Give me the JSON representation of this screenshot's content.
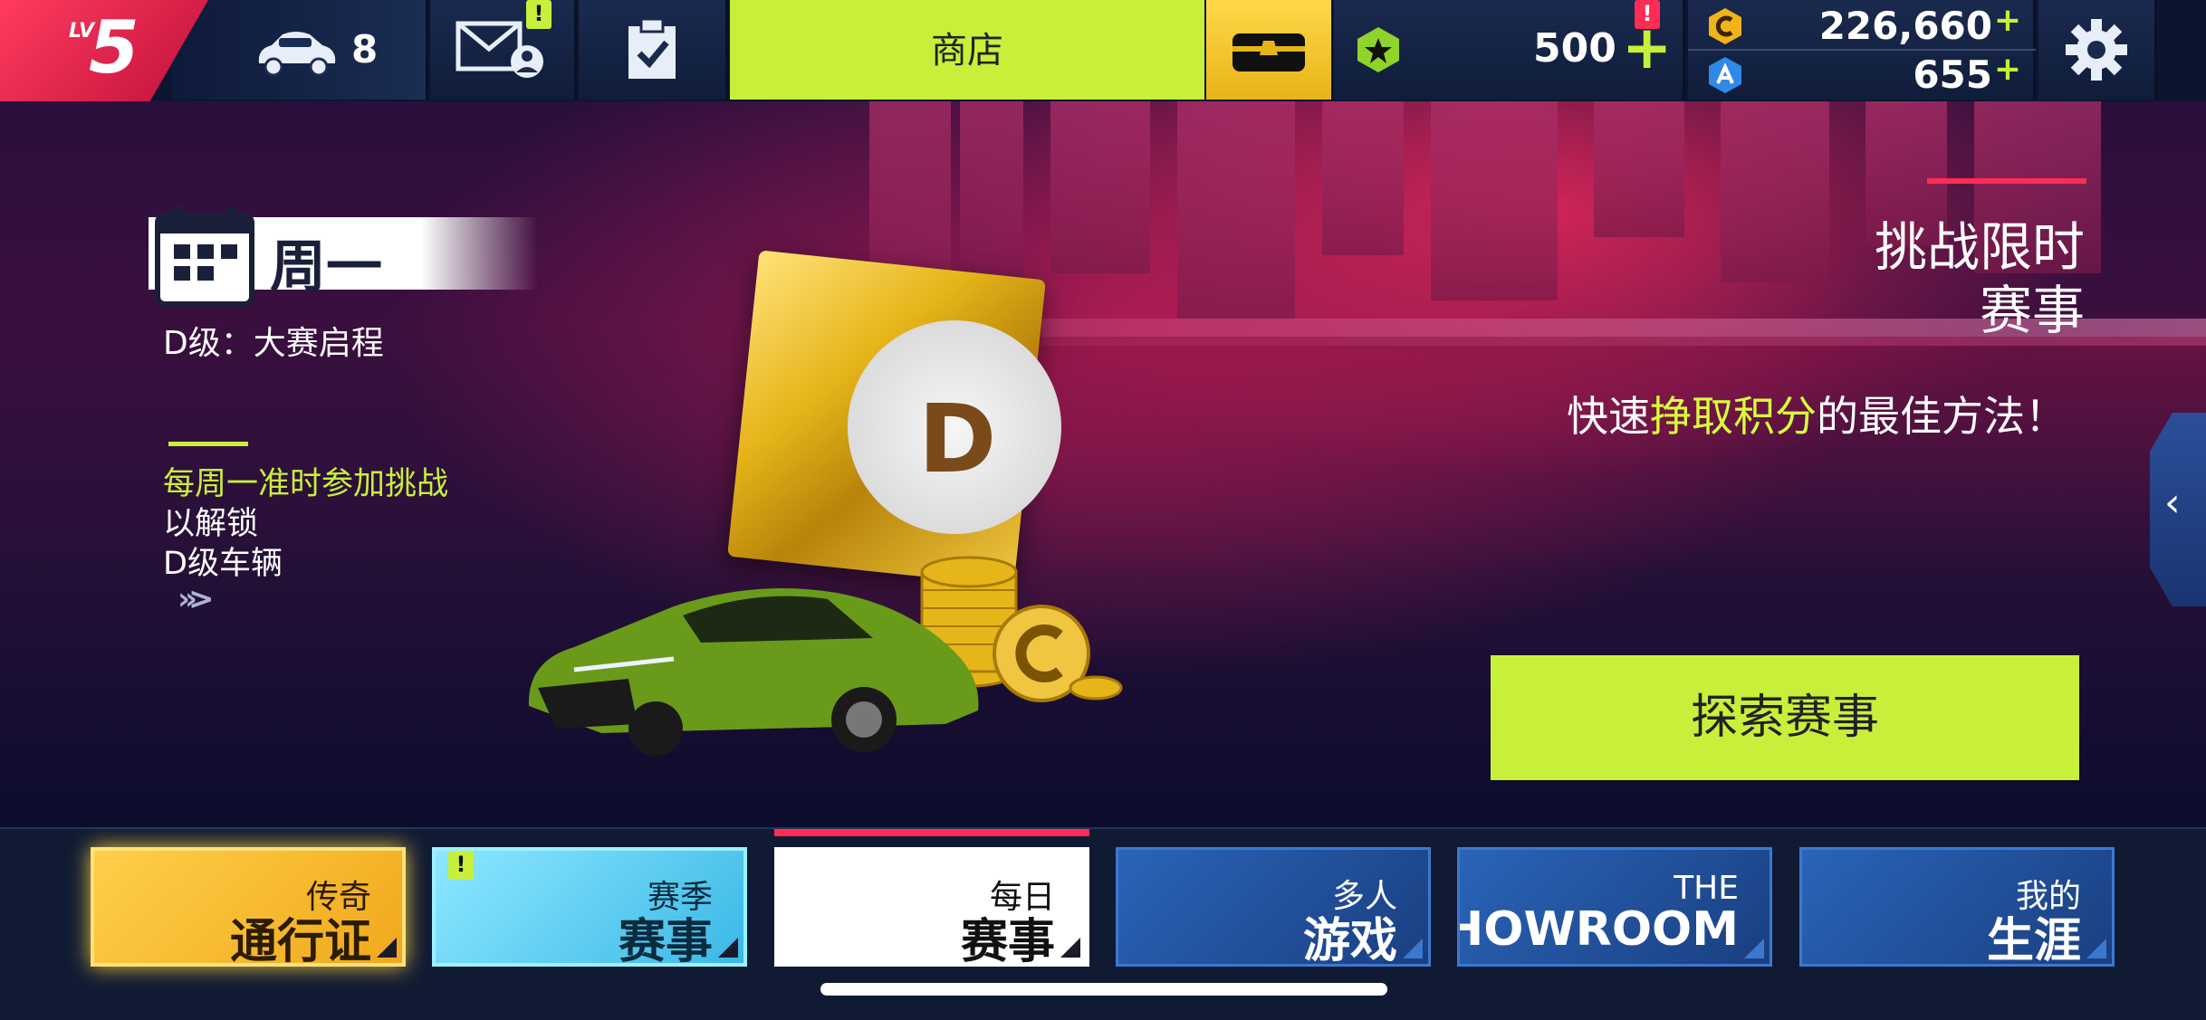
{
  "top_bar": {
    "level_prefix": "LV",
    "level": "5",
    "car_count": "8",
    "mail_alert": "!",
    "shop_label": "商店",
    "tokens": "500",
    "tokens_plus": "+",
    "tokens_alert": "!",
    "credits": "226,660",
    "credits_plus": "+",
    "gems": "655",
    "gems_plus": "+"
  },
  "event": {
    "day": "周一",
    "class_label": "D级：大赛启程",
    "desc_highlight": "每周一准时参加挑战",
    "desc_line2": "以解锁",
    "desc_line3": "D级车辆",
    "more": "»>",
    "badge_letter": "D"
  },
  "promo": {
    "title_line1": "挑战限时",
    "title_line2": "赛事",
    "sub_pre": "快速",
    "sub_highlight": "挣取积分",
    "sub_post": "的最佳方法！",
    "explore_button": "探索赛事"
  },
  "bottom_nav": [
    {
      "line1": "传奇",
      "line2": "通行证"
    },
    {
      "line1": "赛季",
      "line2": "赛事",
      "alert": "!"
    },
    {
      "line1": "每日",
      "line2": "赛事"
    },
    {
      "line1": "多人",
      "line2": "游戏"
    },
    {
      "line1": "THE",
      "line2": "SHOWROOM"
    },
    {
      "line1": "我的",
      "line2": "生涯"
    }
  ],
  "colors": {
    "accent_green": "#c8f03a",
    "accent_red": "#ff2d55",
    "gold": "#f0c640"
  }
}
